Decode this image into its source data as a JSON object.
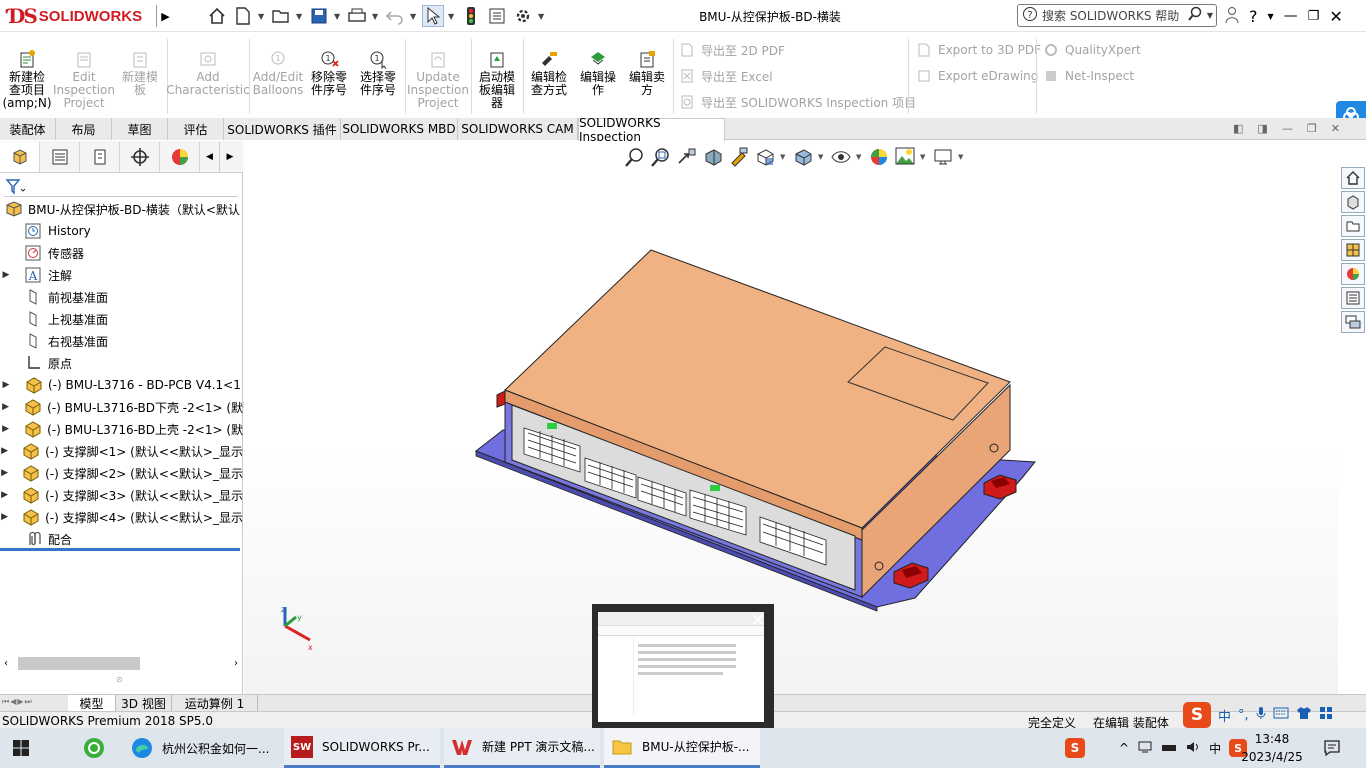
{
  "app": {
    "brand": "SOLIDWORKS",
    "title": "BMU-从控保护板-BD-横装"
  },
  "search": {
    "placeholder": "搜索 SOLIDWORKS 帮助"
  },
  "commands": {
    "new_inspection": {
      "line1": "新建检",
      "line2": "查项目",
      "line3": "(amp;N)"
    },
    "edit_inspection": {
      "line1": "Edit",
      "line2": "Inspection",
      "line3": "Project"
    },
    "new_template": {
      "line1": "新建模",
      "line2": "板"
    },
    "add_characteristic": {
      "line1": "Add",
      "line2": "Characteristic"
    },
    "add_edit_balloons": {
      "line1": "Add/Edit",
      "line2": "Balloons"
    },
    "remove_part_seq": {
      "line1": "移除零",
      "line2": "件序号"
    },
    "select_part_seq": {
      "line1": "选择零",
      "line2": "件序号"
    },
    "update_inspection": {
      "line1": "Update",
      "line2": "Inspection",
      "line3": "Project"
    },
    "launch_template_editor": {
      "line1": "启动模",
      "line2": "板编辑",
      "line3": "器"
    },
    "edit_inspection_method": {
      "line1": "编辑检",
      "line2": "查方式"
    },
    "edit_operation": {
      "line1": "编辑操",
      "line2": "作"
    },
    "edit_vendor": {
      "line1": "编辑卖",
      "line2": "方"
    },
    "export_2d_pdf": "导出至 2D PDF",
    "export_excel": "导出至 Excel",
    "export_sw_inspection": "导出至 SOLIDWORKS Inspection 项目",
    "export_3d_pdf": "Export to 3D PDF",
    "export_edrawing": "Export eDrawing",
    "qualityxpert": "QualityXpert",
    "net_inspect": "Net-Inspect"
  },
  "tabs": [
    "装配体",
    "布局",
    "草图",
    "评估",
    "SOLIDWORKS 插件",
    "SOLIDWORKS MBD",
    "SOLIDWORKS CAM",
    "SOLIDWORKS Inspection"
  ],
  "tree": {
    "root": "BMU-从控保护板-BD-横装（默认<默认",
    "history": "History",
    "sensors": "传感器",
    "annotations": "注解",
    "front_plane": "前视基准面",
    "top_plane": "上视基准面",
    "right_plane": "右视基准面",
    "origin": "原点",
    "parts": [
      "(-) BMU-L3716 - BD-PCB V4.1<1",
      "(-) BMU-L3716-BD下壳 -2<1> (默",
      "(-) BMU-L3716-BD上壳 -2<1> (默",
      "(-) 支撑脚<1> (默认<<默认>_显示",
      "(-) 支撑脚<2> (默认<<默认>_显示",
      "(-) 支撑脚<3> (默认<<默认>_显示",
      "(-) 支撑脚<4> (默认<<默认>_显示"
    ],
    "mates": "配合"
  },
  "bottom_tabs": [
    "模型",
    "3D 视图",
    "运动算例 1"
  ],
  "status": {
    "version": "SOLIDWORKS Premium 2018 SP5.0",
    "defined": "完全定义",
    "editing": "在编辑 装配体"
  },
  "taskbar": {
    "items": [
      "杭州公积金如何一...",
      "SOLIDWORKS Pr...",
      "新建 PPT 演示文稿...",
      "BMU-从控保护板-..."
    ],
    "ime": "中",
    "time": "13:48",
    "date": "2023/4/25"
  },
  "ime_bar": {
    "lang": "中"
  },
  "colors": {
    "accent": "#2f76c8",
    "brand": "#d01c24",
    "box_top": "#f0b283",
    "box_base": "#6f6fe0",
    "feet": "#d11a1a"
  }
}
